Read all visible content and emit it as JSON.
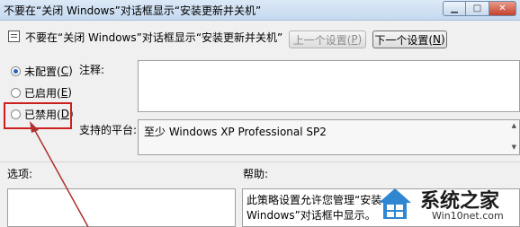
{
  "window": {
    "title": "不要在“关闭 Windows”对话框显示“安装更新并关机”"
  },
  "header": {
    "policy_name": "不要在“关闭 Windows”对话框显示“安装更新并关机”",
    "prev_label": "上一个设置(",
    "prev_key": "P",
    "prev_suffix": ")",
    "next_label": "下一个设置(",
    "next_key": "N",
    "next_suffix": ")"
  },
  "radios": {
    "unconfigured": {
      "label": "未配置(",
      "key": "C",
      "suffix": ")",
      "selected": true
    },
    "enabled": {
      "label": "已启用(",
      "key": "E",
      "suffix": ")",
      "selected": false
    },
    "disabled": {
      "label": "已禁用(",
      "key": "D",
      "suffix": ")",
      "selected": false
    }
  },
  "comment": {
    "label": "注释:",
    "value": ""
  },
  "supported": {
    "label": "支持的平台:",
    "value": "至少 Windows XP Professional SP2"
  },
  "options": {
    "label": "选项:"
  },
  "help": {
    "label": "帮助:",
    "line1": "此策略设置允许您管理“安装",
    "line2": "Windows”对话框中显示。"
  },
  "watermark": {
    "text": "系统之家",
    "url": "Win10net.com"
  },
  "colors": {
    "highlight": "#cc1f1f",
    "arrow": "#b03030",
    "titlebar": "#c5d9ef"
  }
}
